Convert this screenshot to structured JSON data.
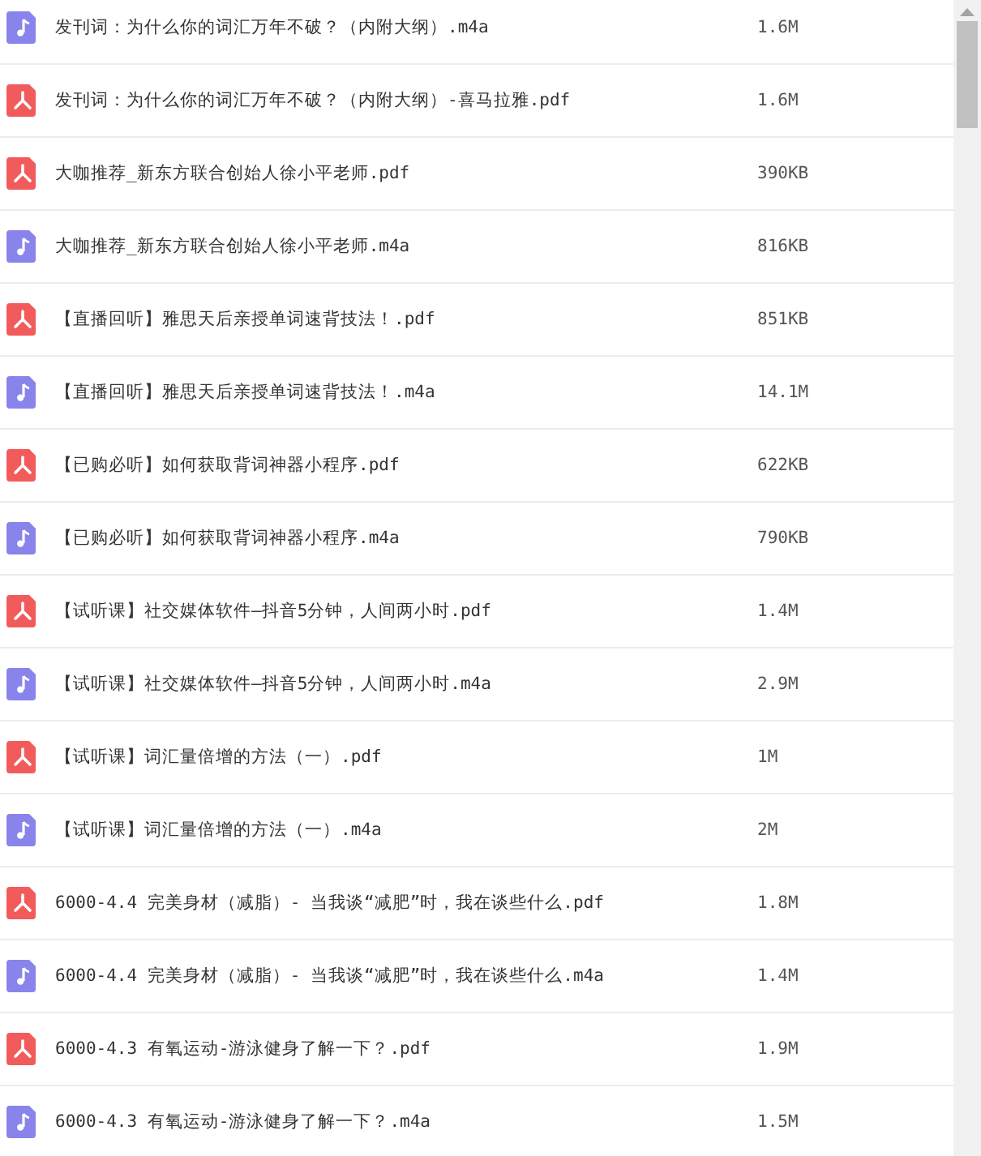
{
  "files": [
    {
      "kind": "audio",
      "name": "发刊词：为什么你的词汇万年不破？（内附大纲）.m4a",
      "size": "1.6M"
    },
    {
      "kind": "pdf",
      "name": "发刊词：为什么你的词汇万年不破？（内附大纲）-喜马拉雅.pdf",
      "size": "1.6M"
    },
    {
      "kind": "pdf",
      "name": "大咖推荐_新东方联合创始人徐小平老师.pdf",
      "size": "390KB"
    },
    {
      "kind": "audio",
      "name": "大咖推荐_新东方联合创始人徐小平老师.m4a",
      "size": "816KB"
    },
    {
      "kind": "pdf",
      "name": "【直播回听】雅思天后亲授单词速背技法！.pdf",
      "size": "851KB"
    },
    {
      "kind": "audio",
      "name": "【直播回听】雅思天后亲授单词速背技法！.m4a",
      "size": "14.1M"
    },
    {
      "kind": "pdf",
      "name": "【已购必听】如何获取背词神器小程序.pdf",
      "size": "622KB"
    },
    {
      "kind": "audio",
      "name": "【已购必听】如何获取背词神器小程序.m4a",
      "size": "790KB"
    },
    {
      "kind": "pdf",
      "name": "【试听课】社交媒体软件—抖音5分钟，人间两小时.pdf",
      "size": "1.4M"
    },
    {
      "kind": "audio",
      "name": "【试听课】社交媒体软件—抖音5分钟，人间两小时.m4a",
      "size": "2.9M"
    },
    {
      "kind": "pdf",
      "name": "【试听课】词汇量倍增的方法（一）.pdf",
      "size": "1M"
    },
    {
      "kind": "audio",
      "name": "【试听课】词汇量倍增的方法（一）.m4a",
      "size": "2M"
    },
    {
      "kind": "pdf",
      "name": "6000-4.4 完美身材（减脂）- 当我谈“减肥”时，我在谈些什么.pdf",
      "size": "1.8M"
    },
    {
      "kind": "audio",
      "name": "6000-4.4 完美身材（减脂）- 当我谈“减肥”时，我在谈些什么.m4a",
      "size": "1.4M"
    },
    {
      "kind": "pdf",
      "name": "6000-4.3 有氧运动-游泳健身了解一下？.pdf",
      "size": "1.9M"
    },
    {
      "kind": "audio",
      "name": "6000-4.3 有氧运动-游泳健身了解一下？.m4a",
      "size": "1.5M"
    }
  ]
}
